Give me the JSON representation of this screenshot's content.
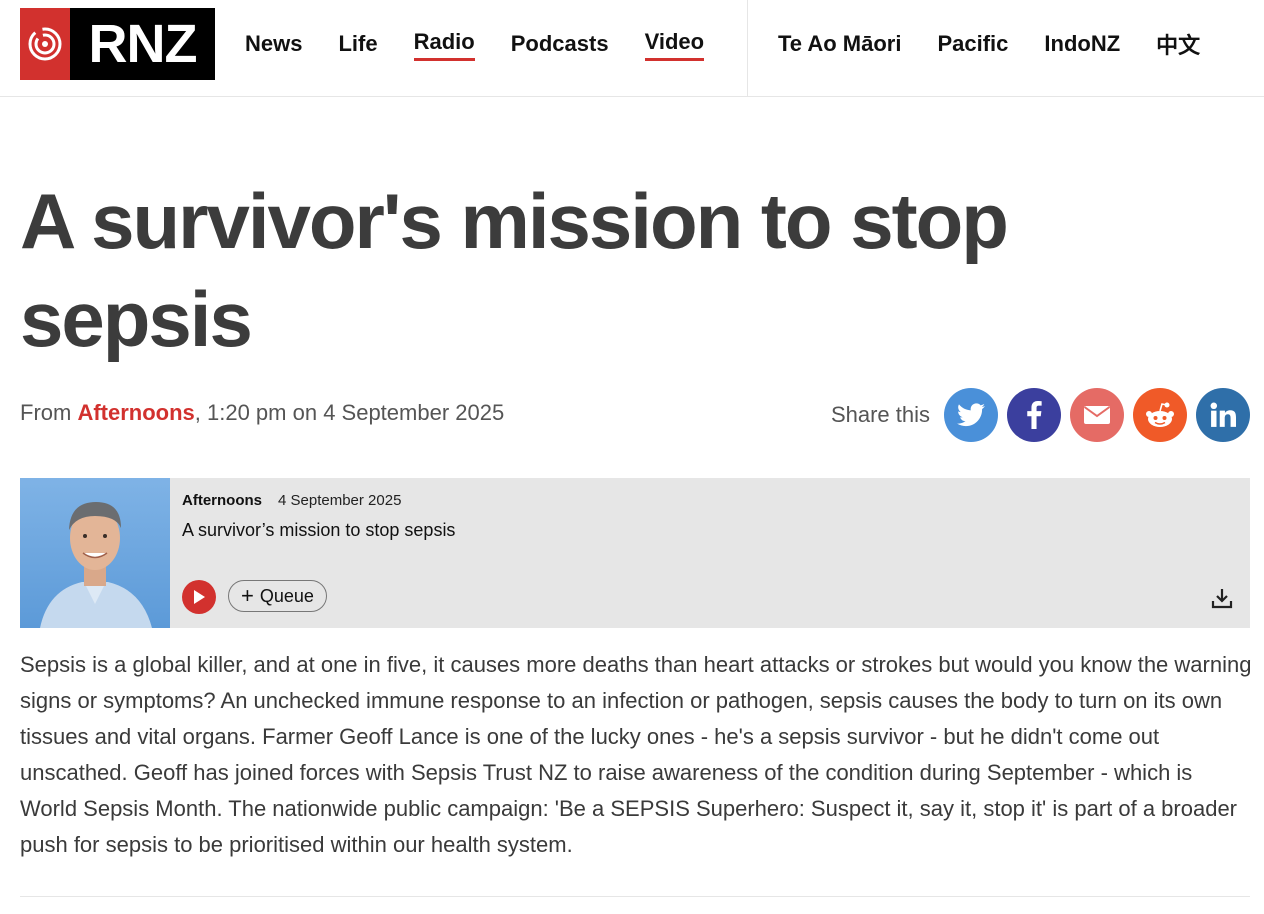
{
  "header": {
    "logo_text": "RNZ",
    "nav_left": [
      "News",
      "Life",
      "Radio",
      "Podcasts",
      "Video"
    ],
    "nav_right": [
      "Te Ao Māori",
      "Pacific",
      "IndoNZ",
      "中文"
    ],
    "active_items": [
      "Radio",
      "Video"
    ]
  },
  "article": {
    "title": "A survivor's mission to stop sepsis",
    "meta_from": "From ",
    "meta_program": "Afternoons",
    "meta_time": ", 1:20 pm on 4 September 2025",
    "body": "Sepsis is a global killer, and at one in five, it causes more deaths than heart attacks or strokes but would you know the warning signs or symptoms? An unchecked immune response to an infection or pathogen, sepsis causes the body to turn on its own tissues and vital organs. Farmer Geoff Lance is one of the lucky ones - he's a sepsis survivor - but he didn't come out unscathed. Geoff has joined forces with Sepsis Trust NZ to raise awareness of the condition during September - which is World Sepsis Month. The nationwide public campaign: 'Be a SEPSIS Superhero: Suspect it, say it, stop it' is part of a broader push for sepsis to be prioritised within our health system."
  },
  "share": {
    "label": "Share this",
    "buttons": [
      {
        "name": "twitter",
        "color": "#4a90d9"
      },
      {
        "name": "facebook",
        "color": "#3b3f9e"
      },
      {
        "name": "email",
        "color": "#e56b65"
      },
      {
        "name": "reddit",
        "color": "#f05a28"
      },
      {
        "name": "linkedin",
        "color": "#2f6fa9"
      }
    ]
  },
  "audio_card": {
    "program": "Afternoons",
    "date": "4 September 2025",
    "title": "A survivor’s mission to stop sepsis",
    "queue_label": "Queue"
  },
  "colors": {
    "brand_red": "#d2312e",
    "title": "#3c3c3c",
    "card_bg": "#e6e6e6"
  }
}
